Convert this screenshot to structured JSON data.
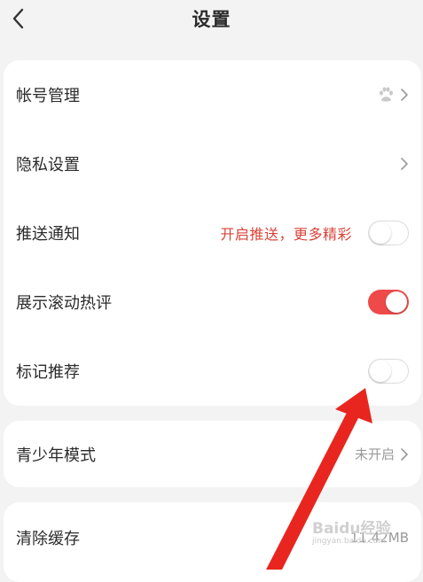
{
  "header": {
    "title": "设置",
    "back_icon": "chevron-left-icon"
  },
  "settings": [
    {
      "label": "帐号管理",
      "right": "baidu-paw-icon + chevron"
    },
    {
      "label": "隐私设置",
      "right": "chevron"
    },
    {
      "label": "推送通知",
      "promo": "开启推送，更多精彩",
      "toggle": "off"
    },
    {
      "label": "展示滚动热评",
      "toggle": "on"
    },
    {
      "label": "标记推荐",
      "toggle": "off"
    }
  ],
  "youth": {
    "label": "青少年模式",
    "value": "未开启"
  },
  "cache": {
    "label": "清除缓存",
    "value": "11.42MB"
  },
  "watermark": {
    "top": "Baidu经验",
    "bottom": "jingyan.baidu.com"
  },
  "colors": {
    "accent": "#ee4a4a",
    "promo": "#d9433a",
    "background": "#f3f3f3",
    "card": "#ffffff"
  }
}
